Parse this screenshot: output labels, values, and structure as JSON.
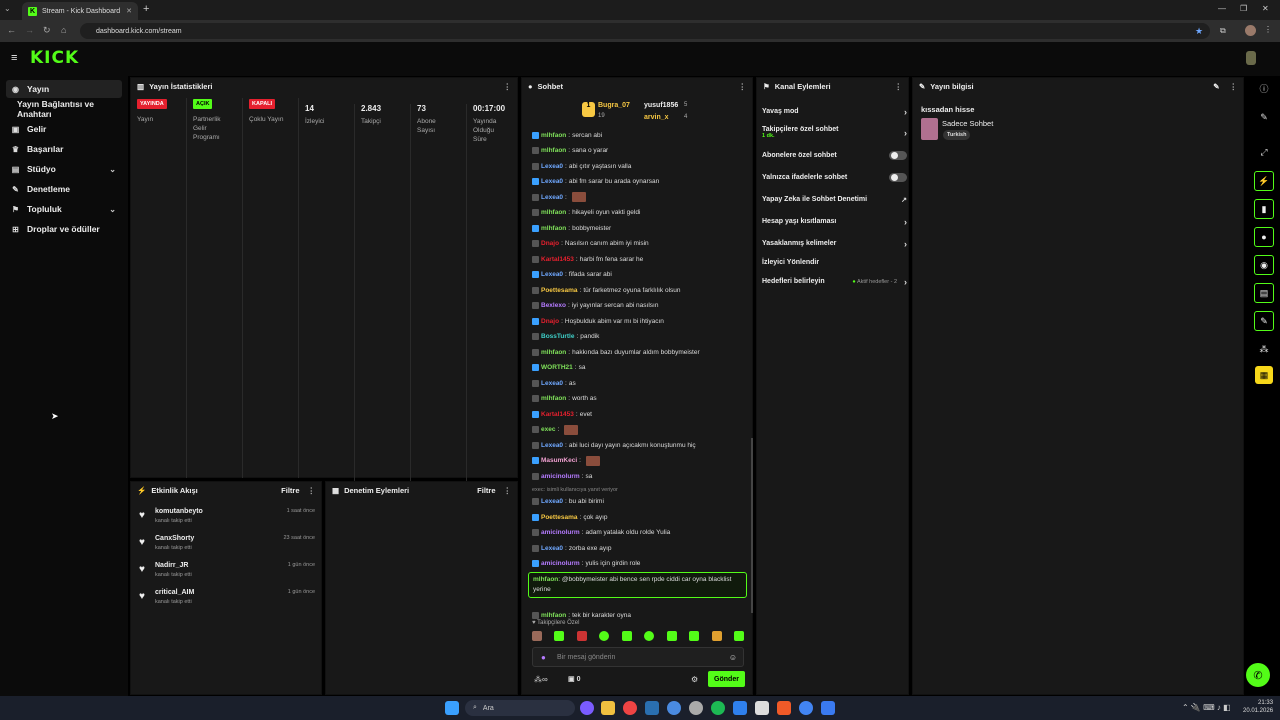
{
  "browser": {
    "tab_title": "Stream - Kick Dashboard",
    "url": "dashboard.kick.com/stream"
  },
  "header": {
    "logo": "KICK"
  },
  "sidebar": {
    "items": [
      {
        "label": "Yayın",
        "icon": "stream-icon"
      },
      {
        "label": "Yayın Bağlantısı ve Anahtarı",
        "icon": "key-icon"
      },
      {
        "label": "Gelir",
        "icon": "money-icon"
      },
      {
        "label": "Başarılar",
        "icon": "trophy-icon"
      },
      {
        "label": "Stüdyo",
        "icon": "studio-icon"
      },
      {
        "label": "Denetleme",
        "icon": "wrench-icon"
      },
      {
        "label": "Topluluk",
        "icon": "community-icon"
      },
      {
        "label": "Droplar ve ödüller",
        "icon": "gift-icon"
      }
    ]
  },
  "stats": {
    "title": "Yayın İstatistikleri",
    "cols": [
      {
        "badge": "YAYINDA",
        "badge_color": "#e5202e",
        "label": "Yayın"
      },
      {
        "badge": "AÇIK",
        "badge_color": "#53fc18",
        "label": "Partnerlik Gelir Programı"
      },
      {
        "badge": "KAPALI",
        "badge_color": "#e5202e",
        "label": "Çoklu Yayın"
      },
      {
        "value": "14",
        "label": "İzleyici"
      },
      {
        "value": "2.843",
        "label": "Takipçi"
      },
      {
        "value": "73",
        "label": "Abone Sayısı"
      },
      {
        "value": "00:17:00",
        "label": "Yayında Olduğu Süre"
      }
    ]
  },
  "activity": {
    "title": "Etkinlik Akışı",
    "filter": "Filtre",
    "items": [
      {
        "user": "komutanbeyto",
        "sub": "kanalı takip etti",
        "time": "1 saat önce"
      },
      {
        "user": "CanxShorty",
        "sub": "kanalı takip etti",
        "time": "23 saat önce"
      },
      {
        "user": "Nadirr_JR",
        "sub": "kanalı takip etti",
        "time": "1 gün önce"
      },
      {
        "user": "critical_AIM",
        "sub": "kanalı takip etti",
        "time": "1 gün önce"
      }
    ]
  },
  "moderation": {
    "title": "Denetim Eylemleri",
    "filter": "Filtre"
  },
  "chat": {
    "title": "Sohbet",
    "top": [
      {
        "name": "Bugra_07",
        "a": "19",
        "b": "5"
      },
      {
        "name": "yusuf1856",
        "a": "5"
      },
      {
        "name": "arvin_x",
        "a": "4"
      }
    ],
    "messages": [
      {
        "name": "mlhfaon",
        "color": "#7fe05a",
        "text": "sercan abi"
      },
      {
        "name": "mlhfaon",
        "color": "#7fe05a",
        "text": "sana o yarar"
      },
      {
        "name": "Lexea0",
        "color": "#6fa8ff",
        "text": "abi çıtır yaştasın valla"
      },
      {
        "name": "Lexea0",
        "color": "#6fa8ff",
        "text": "abi fm sarar bu arada oynarsan"
      },
      {
        "name": "Lexea0",
        "color": "#6fa8ff",
        "text": "",
        "emote": true
      },
      {
        "name": "mlhfaon",
        "color": "#7fe05a",
        "text": "hikayeli oyun vakti geldi"
      },
      {
        "name": "mlhfaon",
        "color": "#7fe05a",
        "text": "bobbymeister"
      },
      {
        "name": "Dnajo",
        "color": "#e5202e",
        "text": "Nasılsın canım abim iyi misin"
      },
      {
        "name": "Kartal1453",
        "color": "#e5202e",
        "text": "harbi fm fena sarar he"
      },
      {
        "name": "Lexea0",
        "color": "#6fa8ff",
        "text": "fifada sarar abi"
      },
      {
        "name": "Poettesama",
        "color": "#f7c843",
        "text": "tür farketmez oyuna farklılık olsun"
      },
      {
        "name": "Bexlexo",
        "color": "#b57bff",
        "text": "iyi yayınlar sercan abi nasılsın"
      },
      {
        "name": "Dnajo",
        "color": "#e5202e",
        "text": "Hoşbulduk abim var mı bi ihtiyacın"
      },
      {
        "name": "BossTurtle",
        "color": "#3fd0c9",
        "text": "pandik"
      },
      {
        "name": "mlhfaon",
        "color": "#7fe05a",
        "text": "hakkında bazı duyumlar aldım bobbymeister"
      },
      {
        "name": "WORTH21",
        "color": "#7fe05a",
        "text": "sa"
      },
      {
        "name": "Lexea0",
        "color": "#6fa8ff",
        "text": "as"
      },
      {
        "name": "mlhfaon",
        "color": "#7fe05a",
        "text": "worth as"
      },
      {
        "name": "Kartal1453",
        "color": "#e5202e",
        "text": "evet"
      },
      {
        "name": "exec",
        "color": "#7fe05a",
        "text": "",
        "emote": true
      },
      {
        "name": "Lexea0",
        "color": "#6fa8ff",
        "text": "abi luci dayı yayın açıcakmı konuştunmu hiç"
      },
      {
        "name": "MasumKeci",
        "color": "#f0a0d0",
        "text": "",
        "emote": true
      },
      {
        "name": "amicinolurm",
        "color": "#b57bff",
        "text": "sa"
      },
      {
        "name": "Lexea0",
        "color": "#6fa8ff",
        "text": "bu abi birimi"
      },
      {
        "name": "Poettesama",
        "color": "#f7c843",
        "text": "çok ayıp"
      },
      {
        "name": "amicinolurm",
        "color": "#b57bff",
        "text": "adam yatalak oldu rolde Yulia"
      },
      {
        "name": "Lexea0",
        "color": "#6fa8ff",
        "text": "zorba exe ayıp"
      },
      {
        "name": "amicinolurm",
        "color": "#b57bff",
        "text": "yulis için girdin role"
      },
      {
        "name": "mlhfaon",
        "color": "#7fe05a",
        "text": "tek bir karakter oyna"
      }
    ],
    "reply_note": "exec: isimli kullanıcıya yanıt veriyor",
    "highlight": {
      "name": "mlhfaon",
      "text": "@bobbymeister abi bence sen rpde ciddi car oyna blacklist yerine"
    },
    "followers_only": "Takipçilere Özel",
    "input_placeholder": "Bir mesaj gönderin",
    "send": "Gönder",
    "bottom_count": "0"
  },
  "channel": {
    "title": "Kanal Eylemleri",
    "items": [
      {
        "label": "Yavaş mod",
        "type": "arrow"
      },
      {
        "label": "Takipçilere özel sohbet",
        "sub": "1 dk.",
        "type": "arrow"
      },
      {
        "label": "Abonelere özel sohbet",
        "type": "toggle"
      },
      {
        "label": "Yalnızca ifadelerle sohbet",
        "type": "toggle"
      },
      {
        "label": "Yapay Zeka ile Sohbet Denetimi",
        "type": "chart"
      },
      {
        "label": "Hesap yaşı kısıtlaması",
        "type": "arrow"
      },
      {
        "label": "Yasaklanmış kelimeler",
        "type": "arrow"
      },
      {
        "label": "İzleyici Yönlendir",
        "type": "none"
      },
      {
        "label": "Hedefleri belirleyin",
        "extra": "Aktif hedefler - 2",
        "type": "arrow"
      }
    ]
  },
  "info": {
    "title": "Yayın bilgisi",
    "stream_title": "kıssadan hisse",
    "category": "Sadece Sohbet",
    "tag": "Turkish"
  },
  "taskbar": {
    "search": "Ara",
    "time": "21:33",
    "date": "20.01.2026"
  },
  "colors": {
    "accent": "#53fc18",
    "live": "#e5202e",
    "panel": "#181818"
  }
}
